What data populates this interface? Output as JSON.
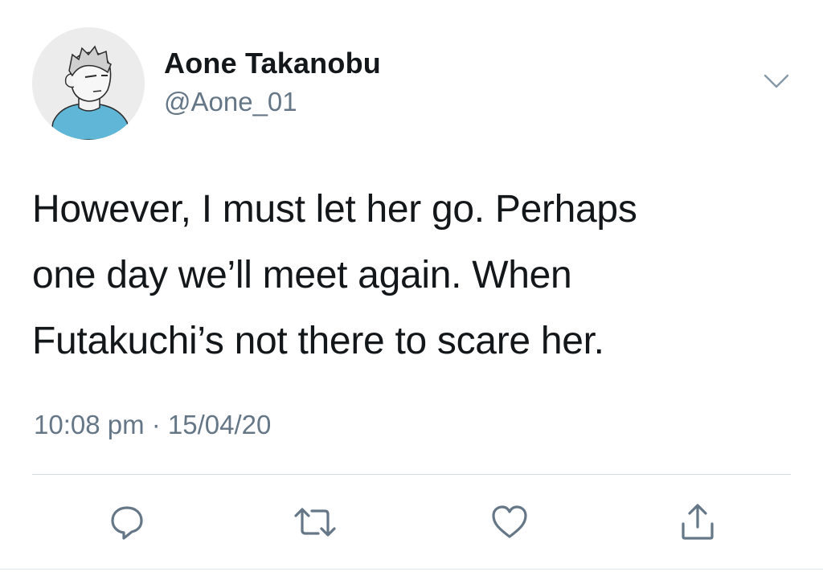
{
  "author": {
    "display_name": "Aone Takanobu",
    "handle": "@Aone_01",
    "avatar_icon": "avatar-illustration"
  },
  "menu": {
    "icon": "chevron-down-icon"
  },
  "tweet": {
    "lines": [
      "However, I must let her go. Perhaps",
      "one day we’ll meet again. When",
      "Futakuchi’s not there to scare her."
    ],
    "time": "10:08 pm",
    "separator": "·",
    "date": "15/04/20",
    "timestamp": "10:08 pm · 15/04/20"
  },
  "actions": [
    {
      "name": "reply",
      "icon": "reply-icon"
    },
    {
      "name": "retweet",
      "icon": "retweet-icon"
    },
    {
      "name": "like",
      "icon": "heart-icon"
    },
    {
      "name": "share",
      "icon": "share-icon"
    }
  ],
  "colors": {
    "text": "#14171a",
    "secondary": "#657786",
    "icon": "#657786",
    "divider": "#d6dbdf"
  }
}
